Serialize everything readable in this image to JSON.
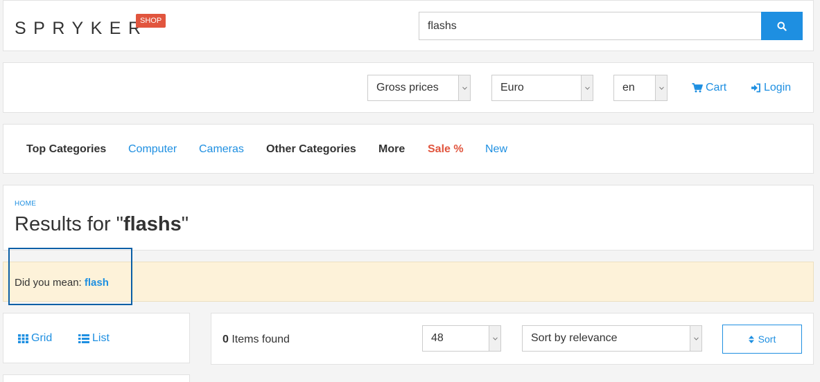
{
  "header": {
    "logo_text": "SPRYKER",
    "shop_badge": "SHOP",
    "search_value": "flashs",
    "search_icon": "search-icon"
  },
  "settings": {
    "price_mode": "Gross prices",
    "currency": "Euro",
    "language": "en",
    "cart_label": "Cart",
    "login_label": "Login"
  },
  "nav": {
    "items": [
      "Top Categories",
      "Computer",
      "Cameras",
      "Other Categories",
      "More",
      "Sale %",
      "New"
    ]
  },
  "results": {
    "breadcrumb": "HOME",
    "title_prefix": "Results for \"",
    "query": "flashs",
    "title_suffix": "\""
  },
  "suggestion": {
    "label": "Did you mean: ",
    "link": "flash"
  },
  "views": {
    "grid_label": "Grid",
    "list_label": "List"
  },
  "toolbar": {
    "count": "0",
    "count_label": " Items found",
    "per_page": "48",
    "sort_option": "Sort by relevance",
    "sort_button": "Sort"
  },
  "colors": {
    "accent": "#1e8fe1",
    "sale": "#e1553e",
    "suggestion_bg": "#fdf2d9",
    "highlight_border": "#0a5fa6"
  }
}
